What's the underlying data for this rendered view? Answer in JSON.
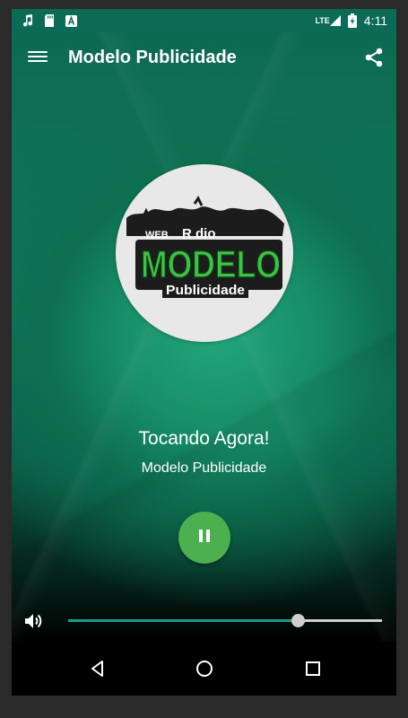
{
  "statusbar": {
    "left_icons": [
      "music-note-icon",
      "sd-card-icon",
      "keyboard-a-icon"
    ],
    "network_label": "LTE",
    "time": "4:11"
  },
  "toolbar": {
    "title": "Modelo Publicidade",
    "menu_icon": "hamburger-menu-icon",
    "share_icon": "share-icon"
  },
  "logo": {
    "web_label": "WEB",
    "radio_label": "R dio",
    "brand_label": "MODELO",
    "sub_label": "Publicidade"
  },
  "now_playing": {
    "title": "Tocando Agora!",
    "station": "Modelo Publicidade"
  },
  "player": {
    "state": "playing",
    "button_icon": "pause-icon",
    "accent_color": "#4caf50"
  },
  "volume": {
    "icon": "volume-icon",
    "level": 0.73,
    "fill_color": "#1a9a8a"
  },
  "navbar": {
    "back_icon": "back-icon",
    "home_icon": "home-icon",
    "recents_icon": "recents-icon"
  },
  "colors": {
    "statusbar": "#0b6b57",
    "background_accent": "#178e67"
  }
}
